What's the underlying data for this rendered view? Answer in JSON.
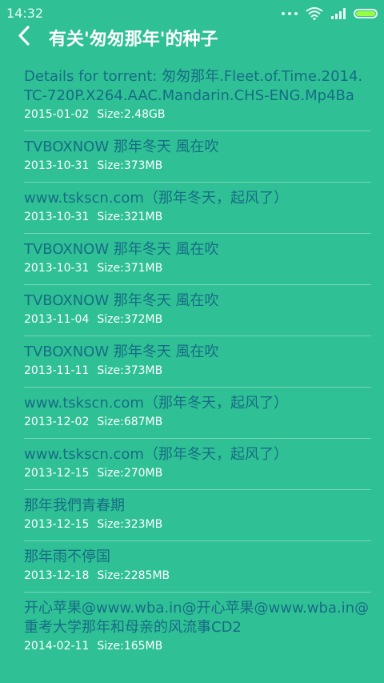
{
  "status": {
    "time": "14:32",
    "battery_fill": 1.0,
    "battery_color": "#98ff3e"
  },
  "header": {
    "title": "有关'匆匆那年'的种子",
    "back_icon": "chevron-left-icon"
  },
  "colors": {
    "background": "#2fc095",
    "title_text": "#166d85",
    "meta_text": "#ffffff"
  },
  "items": [
    {
      "title": "Details for torrent: 匆匆那年.Fleet.of.Time.2014.TC-720P.X264.AAC.Mandarin.CHS-ENG.Mp4Ba",
      "date": "2015-01-02",
      "size": "Size:2.48GB"
    },
    {
      "title": "TVBOXNOW 那年冬天 風在吹",
      "date": "2013-10-31",
      "size": "Size:373MB"
    },
    {
      "title": "www.tskscn.com（那年冬天，起风了）",
      "date": "2013-10-31",
      "size": "Size:321MB"
    },
    {
      "title": "TVBOXNOW 那年冬天 風在吹",
      "date": "2013-10-31",
      "size": "Size:371MB"
    },
    {
      "title": "TVBOXNOW 那年冬天 風在吹",
      "date": "2013-11-04",
      "size": "Size:372MB"
    },
    {
      "title": "TVBOXNOW 那年冬天 風在吹",
      "date": "2013-11-11",
      "size": "Size:373MB"
    },
    {
      "title": "www.tskscn.com（那年冬天，起风了）",
      "date": "2013-12-02",
      "size": "Size:687MB"
    },
    {
      "title": "www.tskscn.com（那年冬天，起风了）",
      "date": "2013-12-15",
      "size": "Size:270MB"
    },
    {
      "title": "那年我們青春期",
      "date": "2013-12-15",
      "size": "Size:323MB"
    },
    {
      "title": "那年雨不停国",
      "date": "2013-12-18",
      "size": "Size:2285MB"
    },
    {
      "title": "开心苹果@www.wba.in@开心苹果@www.wba.in@重考大学那年和母亲的风流事CD2",
      "date": "2014-02-11",
      "size": "Size:165MB"
    }
  ]
}
